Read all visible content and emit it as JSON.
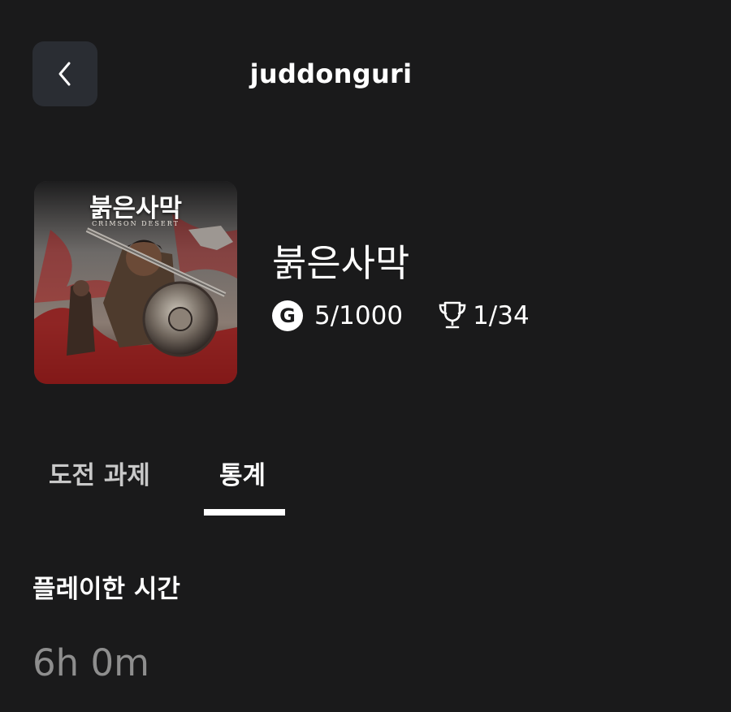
{
  "header": {
    "back_icon": "chevron-left-icon",
    "title": "juddonguri"
  },
  "game": {
    "cover": {
      "title": "붉은사막",
      "subtitle": "CRIMSON DESERT"
    },
    "title": "붉은사막",
    "gamerscore_icon": "G",
    "gamerscore": "5/1000",
    "trophy_icon": "trophy-icon",
    "achievements": "1/34"
  },
  "tabs": [
    {
      "label": "도전 과제",
      "active": false
    },
    {
      "label": "통계",
      "active": true
    }
  ],
  "stats": {
    "heading": "플레이한 시간",
    "value": "6h 0m"
  },
  "colors": {
    "background": "#1a1a1b",
    "back_button": "#2a2d33",
    "text_primary": "#ffffff",
    "text_secondary": "#c9c9c9",
    "text_muted": "#8e8e8e"
  }
}
